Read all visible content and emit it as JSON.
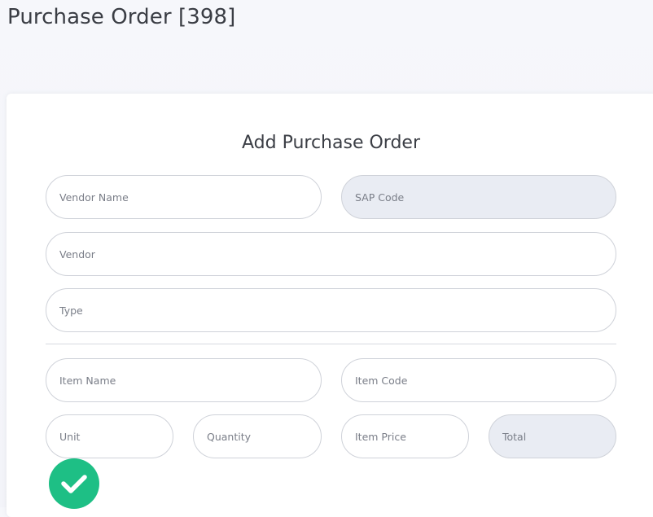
{
  "header": {
    "title": "Purchase Order [398]"
  },
  "form": {
    "title": "Add Purchase Order",
    "vendor_name": {
      "placeholder": "Vendor Name",
      "value": ""
    },
    "sap_code": {
      "placeholder": "SAP Code",
      "value": ""
    },
    "vendor": {
      "placeholder": "Vendor",
      "value": ""
    },
    "type": {
      "placeholder": "Type",
      "value": ""
    },
    "item_name": {
      "placeholder": "Item Name",
      "value": ""
    },
    "item_code": {
      "placeholder": "Item Code",
      "value": ""
    },
    "unit": {
      "placeholder": "Unit",
      "value": ""
    },
    "quantity": {
      "placeholder": "Quantity",
      "value": ""
    },
    "item_price": {
      "placeholder": "Item Price",
      "value": ""
    },
    "total": {
      "placeholder": "Total",
      "value": ""
    },
    "submit": {
      "icon": "check-icon"
    }
  },
  "colors": {
    "accent": "#1ebf85",
    "readonly_background": "#e9ecf3",
    "page_background": "#f4f5fa"
  }
}
